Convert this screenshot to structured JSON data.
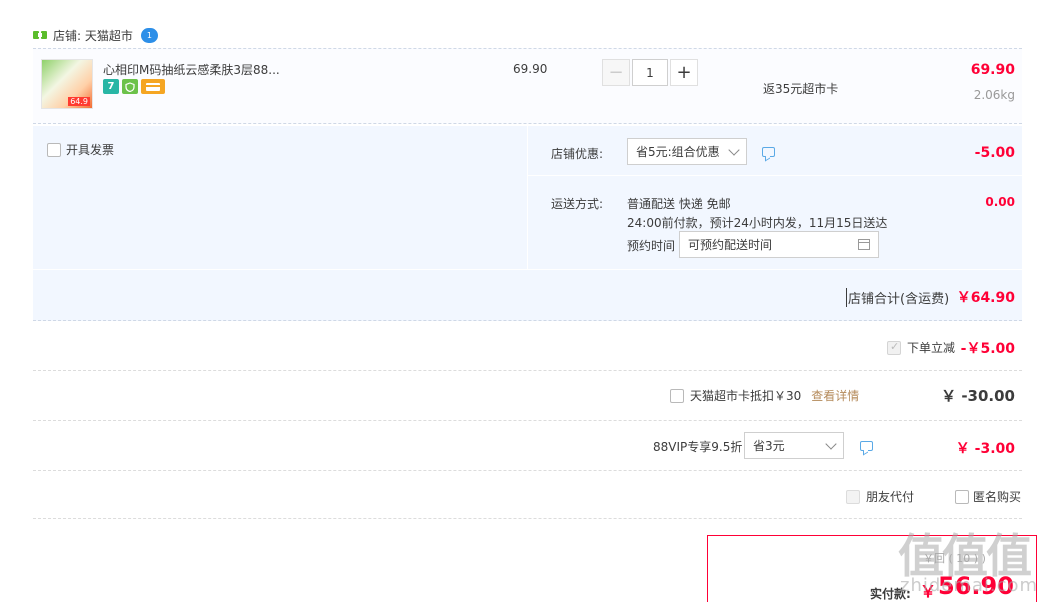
{
  "shop": {
    "label": "店铺: 天猫超市",
    "ww_badge": "1"
  },
  "item": {
    "title": "心相印M码抽纸云感柔肤3层88...",
    "thumb_price": "64.9",
    "badge_7": "7",
    "unit_price": "69.90",
    "quantity": "1",
    "minus": "−",
    "plus": "+",
    "cashback": "返35元超市卡",
    "line_total": "69.90",
    "weight": "2.06kg"
  },
  "options": {
    "invoice_label": "开具发票",
    "shop_discount_label": "店铺优惠:",
    "shop_discount_select": "省5元:组合优惠",
    "shop_discount_amount": "-5.00",
    "delivery_label": "运送方式:",
    "delivery_method": "普通配送 快递 免邮",
    "delivery_eta": "24:00前付款，预计24小时内发，11月15日送达",
    "reserve_label": "预约时间",
    "reserve_placeholder": "可预约配送时间",
    "delivery_amount": "0.00"
  },
  "shop_total": {
    "label": "店铺合计(含运费)",
    "amount": "￥64.90"
  },
  "summary": {
    "instant_discount_label": "下单立减",
    "instant_discount_amount": "-￥5.00",
    "card_deduct_label": "天猫超市卡抵扣￥30",
    "card_deduct_link": "查看详情",
    "card_deduct_amount": "￥ -30.00",
    "vip_label": "88VIP专享9.5折",
    "vip_select": "省3元",
    "vip_amount": "￥ -3.00",
    "friend_pay": "朋友代付",
    "anonymous": "匿名购买"
  },
  "payment": {
    "label": "实付款:",
    "currency": "￥",
    "amount": "56.90",
    "faded_text": "￥回 ( 10 ) )"
  },
  "watermark": {
    "logo": "值值值",
    "site": "zhidemai.com"
  },
  "colors": {
    "accent": "#ff0036",
    "panel": "#f2f7ff",
    "link": "#b48a5a"
  }
}
